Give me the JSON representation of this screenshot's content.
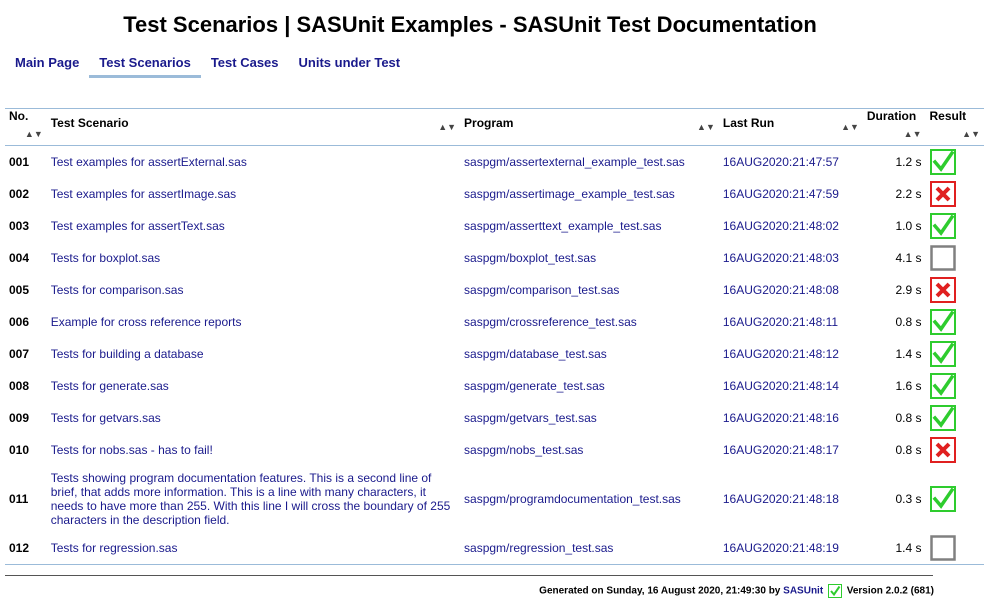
{
  "page": {
    "title": "Test Scenarios | SASUnit Examples - SASUnit Test Documentation"
  },
  "nav": [
    {
      "label": "Main Page",
      "active": false
    },
    {
      "label": "Test Scenarios",
      "active": true
    },
    {
      "label": "Test Cases",
      "active": false
    },
    {
      "label": "Units under Test",
      "active": false
    }
  ],
  "table": {
    "headers": {
      "no": "No.",
      "scenario": "Test Scenario",
      "program": "Program",
      "last_run": "Last Run",
      "duration": "Duration",
      "result": "Result"
    },
    "rows": [
      {
        "no": "001",
        "scenario": "Test examples for assertExternal.sas",
        "program": "saspgm/assertexternal_example_test.sas",
        "last_run": "16AUG2020:21:47:57",
        "duration": "1.2 s",
        "result": "ok"
      },
      {
        "no": "002",
        "scenario": "Test examples for assertImage.sas",
        "program": "saspgm/assertimage_example_test.sas",
        "last_run": "16AUG2020:21:47:59",
        "duration": "2.2 s",
        "result": "error"
      },
      {
        "no": "003",
        "scenario": "Test examples for assertText.sas",
        "program": "saspgm/asserttext_example_test.sas",
        "last_run": "16AUG2020:21:48:02",
        "duration": "1.0 s",
        "result": "ok"
      },
      {
        "no": "004",
        "scenario": "Tests for boxplot.sas",
        "program": "saspgm/boxplot_test.sas",
        "last_run": "16AUG2020:21:48:03",
        "duration": "4.1 s",
        "result": "manual"
      },
      {
        "no": "005",
        "scenario": "Tests for comparison.sas",
        "program": "saspgm/comparison_test.sas",
        "last_run": "16AUG2020:21:48:08",
        "duration": "2.9 s",
        "result": "error"
      },
      {
        "no": "006",
        "scenario": "Example for cross reference reports",
        "program": "saspgm/crossreference_test.sas",
        "last_run": "16AUG2020:21:48:11",
        "duration": "0.8 s",
        "result": "ok"
      },
      {
        "no": "007",
        "scenario": "Tests for building a database",
        "program": "saspgm/database_test.sas",
        "last_run": "16AUG2020:21:48:12",
        "duration": "1.4 s",
        "result": "ok"
      },
      {
        "no": "008",
        "scenario": "Tests for generate.sas",
        "program": "saspgm/generate_test.sas",
        "last_run": "16AUG2020:21:48:14",
        "duration": "1.6 s",
        "result": "ok"
      },
      {
        "no": "009",
        "scenario": "Tests for getvars.sas",
        "program": "saspgm/getvars_test.sas",
        "last_run": "16AUG2020:21:48:16",
        "duration": "0.8 s",
        "result": "ok"
      },
      {
        "no": "010",
        "scenario": "Tests for nobs.sas - has to fail!",
        "program": "saspgm/nobs_test.sas",
        "last_run": "16AUG2020:21:48:17",
        "duration": "0.8 s",
        "result": "error"
      },
      {
        "no": "011",
        "scenario": "Tests showing program documentation features. This is a second line of brief, that adds more information. This is a line with many characters, it needs to have more than 255. With this line I will cross the boundary of 255 characters in the description field.",
        "program": "saspgm/programdocumentation_test.sas",
        "last_run": "16AUG2020:21:48:18",
        "duration": "0.3 s",
        "result": "ok"
      },
      {
        "no": "012",
        "scenario": "Tests for regression.sas",
        "program": "saspgm/regression_test.sas",
        "last_run": "16AUG2020:21:48:19",
        "duration": "1.4 s",
        "result": "manual"
      }
    ]
  },
  "footer": {
    "generated": "Generated on Sunday, 16 August 2020, 21:49:30 by",
    "brand": "SASUnit",
    "version": "Version 2.0.2 (681)"
  },
  "colors": {
    "ok": "#2ecc2e",
    "error": "#e02020",
    "manual": "#808080",
    "link": "#1a1a8c"
  }
}
